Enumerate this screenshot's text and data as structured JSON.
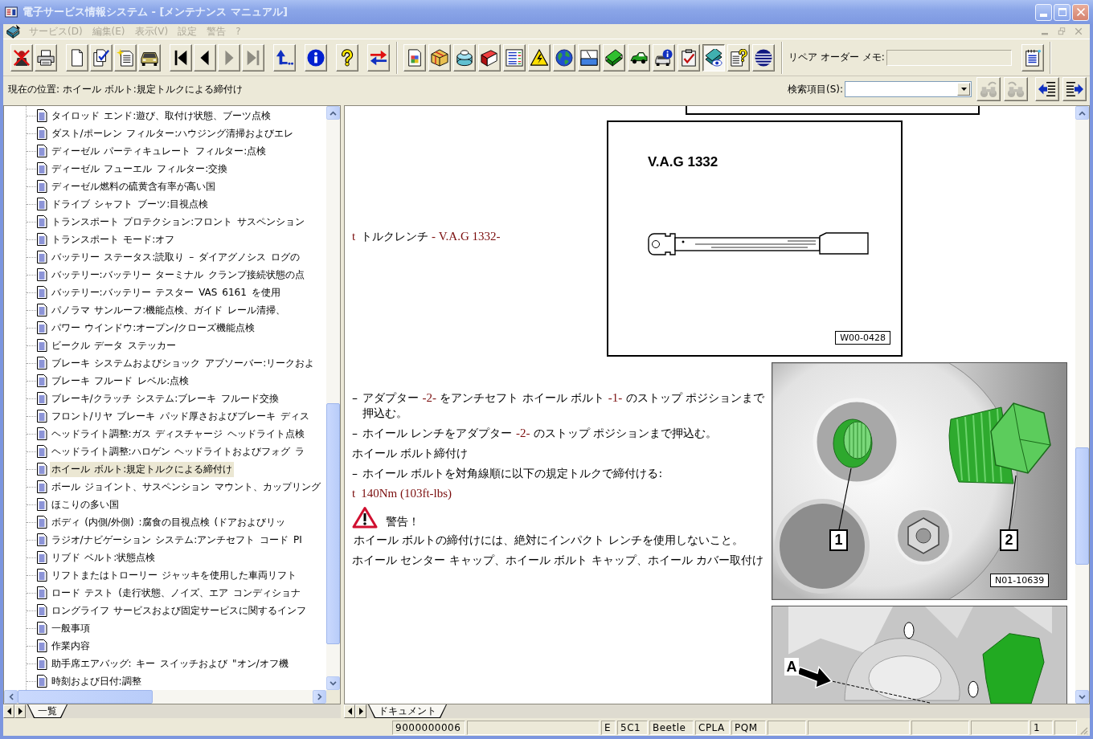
{
  "window": {
    "title": "電子サービス情報システム - [メンテナンス マニュアル]"
  },
  "menu": [
    {
      "label": "サービス(D)",
      "disabled": true
    },
    {
      "label": "編集(E)",
      "disabled": true
    },
    {
      "label": "表示(V)",
      "disabled": true
    },
    {
      "label": "設定",
      "disabled": true
    },
    {
      "label": "警告",
      "disabled": true
    },
    {
      "label": "?",
      "disabled": true
    }
  ],
  "mdi_buttons": [
    {
      "kind": "minimize",
      "disabled": true
    },
    {
      "kind": "restore",
      "disabled": true
    },
    {
      "kind": "close",
      "disabled": true
    }
  ],
  "toolbar": {
    "bands": [
      {
        "groups": [
          [
            {
              "kind": "person-cross",
              "pressed": false,
              "disabled": false
            },
            {
              "kind": "printer",
              "pressed": false,
              "disabled": false
            }
          ],
          [
            {
              "kind": "page",
              "pressed": false,
              "disabled": false
            },
            {
              "kind": "pages-check",
              "pressed": false,
              "disabled": false
            },
            {
              "kind": "page-star",
              "pressed": false,
              "disabled": false
            },
            {
              "kind": "car",
              "pressed": false,
              "disabled": false
            }
          ],
          [
            {
              "kind": "first",
              "pressed": false,
              "disabled": false
            },
            {
              "kind": "prev",
              "pressed": false,
              "disabled": false
            },
            {
              "kind": "next",
              "pressed": false,
              "disabled": true
            },
            {
              "kind": "last",
              "pressed": false,
              "disabled": true
            }
          ],
          [
            {
              "kind": "return",
              "pressed": false,
              "disabled": false
            }
          ],
          [
            {
              "kind": "info",
              "pressed": false,
              "disabled": false
            }
          ],
          [
            {
              "kind": "help",
              "pressed": false,
              "disabled": false
            }
          ],
          [
            {
              "kind": "swap",
              "pressed": false,
              "disabled": false
            }
          ]
        ]
      },
      {
        "groups": [
          [
            {
              "kind": "doc-grid",
              "pressed": false,
              "disabled": false
            },
            {
              "kind": "box",
              "pressed": false,
              "disabled": false
            },
            {
              "kind": "stack",
              "pressed": false,
              "disabled": false
            },
            {
              "kind": "book",
              "pressed": false,
              "disabled": false
            },
            {
              "kind": "list",
              "pressed": false,
              "disabled": false
            },
            {
              "kind": "high-voltage",
              "pressed": false,
              "disabled": false
            },
            {
              "kind": "globe",
              "pressed": false,
              "disabled": false
            },
            {
              "kind": "window",
              "pressed": false,
              "disabled": false
            },
            {
              "kind": "block",
              "pressed": false,
              "disabled": false
            },
            {
              "kind": "green-car",
              "pressed": false,
              "disabled": false
            },
            {
              "kind": "car-info",
              "pressed": false,
              "disabled": false
            },
            {
              "kind": "clipboard",
              "pressed": false,
              "disabled": false
            },
            {
              "kind": "block-eye",
              "pressed": true,
              "disabled": false
            },
            {
              "kind": "doc-question",
              "pressed": false,
              "disabled": false
            },
            {
              "kind": "striped",
              "pressed": false,
              "disabled": false
            }
          ]
        ]
      }
    ],
    "memo": {
      "label": "リペア オーダー メモ:",
      "disabled": true,
      "button": {
        "kind": "notepad",
        "pressed": false,
        "disabled": false
      }
    }
  },
  "location": "現在の位置: ホイール ボルト:規定トルクによる締付け",
  "search": {
    "label": "検索項目(S):",
    "buttons": [
      {
        "kind": "find-next",
        "disabled": true
      },
      {
        "kind": "find-previous",
        "disabled": true
      },
      {
        "kind": "collapse",
        "disabled": false
      },
      {
        "kind": "expand",
        "disabled": false
      }
    ]
  },
  "tree": {
    "items": [
      {
        "label": "タイロッド エンド:遊び、取付け状態、ブーツ点検",
        "selected": false
      },
      {
        "label": "ダスト/ポーレン フィルター:ハウジング清掃およびエレ",
        "selected": false
      },
      {
        "label": "ディーゼル パーティキュレート フィルター:点検",
        "selected": false
      },
      {
        "label": "ディーゼル フューエル フィルター:交換",
        "selected": false
      },
      {
        "label": "ディーゼル燃料の硫黄含有率が高い国",
        "selected": false
      },
      {
        "label": "ドライブ シャフト ブーツ:目視点検",
        "selected": false
      },
      {
        "label": "トランスポート プロテクション:フロント サスペンション",
        "selected": false
      },
      {
        "label": "トランスポート モード:オフ",
        "selected": false
      },
      {
        "label": "バッテリー ステータス:読取り – ダイアグノシス ログの",
        "selected": false
      },
      {
        "label": "バッテリー:バッテリー ターミナル クランプ接続状態の点",
        "selected": false
      },
      {
        "label": "バッテリー:バッテリー テスター VAS 6161 を使用",
        "selected": false
      },
      {
        "label": "パノラマ サンルーフ:機能点検、ガイド レール清掃、",
        "selected": false
      },
      {
        "label": "パワー ウインドウ:オープン/クローズ機能点検",
        "selected": false
      },
      {
        "label": "ビークル データ ステッカー",
        "selected": false
      },
      {
        "label": "ブレーキ システムおよびショック アブソーバー:リークおよ",
        "selected": false
      },
      {
        "label": "ブレーキ フルード レベル:点検",
        "selected": false
      },
      {
        "label": "ブレーキ/クラッチ システム:ブレーキ フルード交換",
        "selected": false
      },
      {
        "label": "フロント/リヤ ブレーキ パッド厚さおよびブレーキ ディス",
        "selected": false
      },
      {
        "label": "ヘッドライト調整:ガス ディスチャージ ヘッドライト点検",
        "selected": false
      },
      {
        "label": "ヘッドライト調整:ハロゲン ヘッドライトおよびフォグ ラ",
        "selected": false
      },
      {
        "label": "ホイール ボルト:規定トルクによる締付け",
        "selected": true
      },
      {
        "label": "ボール ジョイント、サスペンション マウント、カップリング",
        "selected": false
      },
      {
        "label": "ほこりの多い国",
        "selected": false
      },
      {
        "label": "ボディ (内側/外側) :腐食の目視点検 (ドアおよびリッ",
        "selected": false
      },
      {
        "label": "ラジオ/ナビゲーション システム:アンチセフト コード PI",
        "selected": false
      },
      {
        "label": "リブド ベルト:状態点検",
        "selected": false
      },
      {
        "label": "リフトまたはトローリー ジャッキを使用した車両リフト",
        "selected": false
      },
      {
        "label": "ロード テスト (走行状態、ノイズ、エア コンディショナ",
        "selected": false
      },
      {
        "label": "ロングライフ サービスおよび固定サービスに関するインフ",
        "selected": false
      },
      {
        "label": "一般事項",
        "selected": false
      },
      {
        "label": "作業内容",
        "selected": false
      },
      {
        "label": "助手席エアバッグ: キー スイッチおよび \"オン/オフ機",
        "selected": false
      },
      {
        "label": "時刻および日付:調整",
        "selected": false
      }
    ]
  },
  "left_tabs": [
    {
      "label": "一覧",
      "selected": true
    }
  ],
  "document": {
    "rows": [
      {
        "kind": "continued"
      },
      {
        "kind": "tool",
        "items": [
          {
            "kind": "tool",
            "bullet": "t",
            "parts": [
              {
                "kind": "text",
                "text": "トルクレンチ"
              },
              {
                "kind": "ref",
                "text": " - V.A.G 1332-"
              }
            ]
          }
        ],
        "figure": {
          "kind": "tool",
          "title": "V.A.G 1332",
          "code": "W00-0428"
        }
      },
      {
        "kind": "steps",
        "items": [
          {
            "kind": "step",
            "bullet": "–",
            "parts": [
              {
                "kind": "text",
                "text": "アダプター "
              },
              {
                "kind": "ref",
                "text": "-2-"
              },
              {
                "kind": "text",
                "text": " をアンチセフト ホイール ボルト "
              },
              {
                "kind": "ref",
                "text": "-1-"
              },
              {
                "kind": "text",
                "text": " のストップ ポジションまで押込む。"
              }
            ]
          },
          {
            "kind": "step",
            "bullet": "–",
            "parts": [
              {
                "kind": "text",
                "text": "ホイール レンチをアダプター "
              },
              {
                "kind": "ref",
                "text": "-2-"
              },
              {
                "kind": "text",
                "text": " のストップ ポジションまで押込む。"
              }
            ]
          },
          {
            "kind": "text",
            "parts": [
              {
                "kind": "text",
                "text": "ホイール ボルト締付け"
              }
            ]
          },
          {
            "kind": "step",
            "bullet": "–",
            "parts": [
              {
                "kind": "text",
                "text": "ホイール ボルトを対角線順に以下の規定トルクで締付ける:"
              }
            ]
          },
          {
            "kind": "spec",
            "bullet": "t",
            "parts": [
              {
                "kind": "ref",
                "text": "140Nm (103ft-lbs)"
              }
            ]
          },
          {
            "kind": "warning",
            "title": "警告！",
            "parts": [
              {
                "kind": "text",
                "text": "ホイール ボルトの締付けには、絶対にインパクト レンチを使用しないこと。"
              }
            ]
          },
          {
            "kind": "text",
            "parts": [
              {
                "kind": "text",
                "text": "ホイール センター キャップ、ホイール ボルト キャップ、ホイール カバー取付け"
              }
            ]
          }
        ],
        "figure": {
          "kind": "wheel",
          "callouts": [
            "1",
            "2"
          ],
          "code": "N01-10639"
        }
      },
      {
        "kind": "steps",
        "figure": {
          "kind": "detail",
          "callouts": [
            "A"
          ]
        }
      }
    ]
  },
  "document_tabs": [
    {
      "label": "ドキュメント",
      "selected": true
    }
  ],
  "status_bar": [
    {
      "kind": "text",
      "text": "9000000006"
    },
    {
      "kind": "blank"
    },
    {
      "kind": "text",
      "text": "E"
    },
    {
      "kind": "text",
      "text": "5C1"
    },
    {
      "kind": "text",
      "text": "Beetle"
    },
    {
      "kind": "text",
      "text": "CPLA"
    },
    {
      "kind": "text",
      "text": "PQM"
    },
    {
      "kind": "blank"
    },
    {
      "kind": "blank"
    },
    {
      "kind": "blank"
    },
    {
      "kind": "blank"
    },
    {
      "kind": "text",
      "text": "1"
    },
    {
      "kind": "blank"
    }
  ]
}
